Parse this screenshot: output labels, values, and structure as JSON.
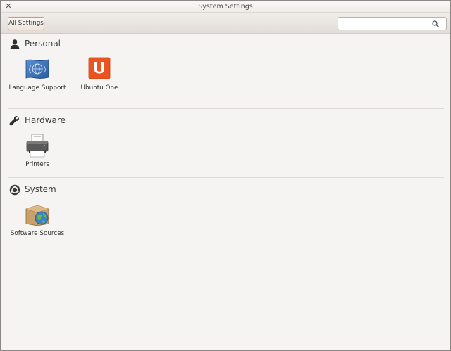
{
  "window": {
    "title": "System Settings"
  },
  "toolbar": {
    "all_settings_label": "All Settings",
    "search": {
      "value": "",
      "placeholder": ""
    }
  },
  "sections": {
    "personal": {
      "title": "Personal",
      "items": [
        {
          "label": "Language Support"
        },
        {
          "label": "Ubuntu One"
        }
      ]
    },
    "hardware": {
      "title": "Hardware",
      "items": [
        {
          "label": "Printers"
        }
      ]
    },
    "system": {
      "title": "System",
      "items": [
        {
          "label": "Software Sources"
        }
      ]
    }
  },
  "colors": {
    "accent": "#e0917a",
    "ubuntu_orange": "#e95420",
    "background": "#f5f4f2"
  },
  "icons": {
    "close": "close-icon",
    "search": "search-icon",
    "personal": "person-icon",
    "hardware": "wrench-icon",
    "system": "gear-icon",
    "language_support": "language-flag-icon",
    "ubuntu_one": "ubuntu-one-icon",
    "printers": "printer-icon",
    "software_sources": "package-globe-icon"
  }
}
